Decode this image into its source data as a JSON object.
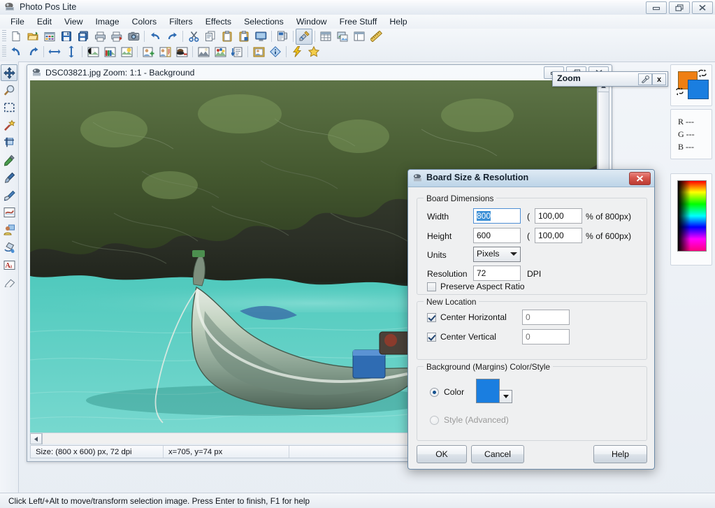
{
  "window": {
    "title": "Photo Pos Lite",
    "icon": "app-icon",
    "controls": [
      {
        "name": "minimize-button",
        "glyph": "minimize"
      },
      {
        "name": "restore-button",
        "glyph": "restore"
      },
      {
        "name": "close-button",
        "glyph": "close"
      }
    ]
  },
  "menu": {
    "items": [
      {
        "label": "File"
      },
      {
        "label": "Edit"
      },
      {
        "label": "View"
      },
      {
        "label": "Image"
      },
      {
        "label": "Colors"
      },
      {
        "label": "Filters"
      },
      {
        "label": "Effects"
      },
      {
        "label": "Selections"
      },
      {
        "label": "Window"
      },
      {
        "label": "Free Stuff"
      },
      {
        "label": "Help"
      }
    ]
  },
  "toolbar": {
    "row1": [
      {
        "name": "new-file-icon"
      },
      {
        "name": "open-file-icon"
      },
      {
        "name": "open-template-icon"
      },
      {
        "name": "save-icon"
      },
      {
        "name": "save-as-icon"
      },
      {
        "name": "print-icon"
      },
      {
        "name": "print-batch-icon"
      },
      {
        "name": "capture-camera-icon"
      },
      {
        "name": "separator"
      },
      {
        "name": "undo-icon"
      },
      {
        "name": "redo-icon"
      },
      {
        "name": "separator"
      },
      {
        "name": "cut-icon"
      },
      {
        "name": "copy-icon"
      },
      {
        "name": "paste-icon"
      },
      {
        "name": "paste-as-new-icon"
      },
      {
        "name": "screen-capture-icon"
      },
      {
        "name": "separator"
      },
      {
        "name": "scanner-icon"
      },
      {
        "name": "separator"
      },
      {
        "name": "board-size-icon"
      },
      {
        "name": "separator"
      },
      {
        "name": "grid-icon"
      },
      {
        "name": "layers-icon"
      },
      {
        "name": "frame-icon"
      },
      {
        "name": "ruler-icon"
      }
    ],
    "row2": [
      {
        "name": "rotate-left-icon"
      },
      {
        "name": "rotate-right-icon"
      },
      {
        "name": "separator"
      },
      {
        "name": "flip-horizontal-icon"
      },
      {
        "name": "flip-vertical-icon"
      },
      {
        "name": "separator"
      },
      {
        "name": "brightness-contrast-icon"
      },
      {
        "name": "color-balance-icon"
      },
      {
        "name": "enhance-icon"
      },
      {
        "name": "separator"
      },
      {
        "name": "add-layer-icon"
      },
      {
        "name": "layer-properties-icon"
      },
      {
        "name": "mask-icon"
      },
      {
        "name": "separator"
      },
      {
        "name": "histogram-icon"
      },
      {
        "name": "color-levels-icon"
      },
      {
        "name": "sort-icon"
      },
      {
        "name": "separator"
      },
      {
        "name": "picture-frame-icon"
      },
      {
        "name": "info-icon"
      },
      {
        "name": "separator"
      },
      {
        "name": "quick-effects-icon"
      },
      {
        "name": "favorites-star-icon"
      }
    ]
  },
  "tools": [
    {
      "name": "tool-move",
      "label": "Move",
      "selected": true
    },
    {
      "name": "tool-zoom",
      "label": "Zoom",
      "selected": false
    },
    {
      "name": "tool-select-rectangle",
      "label": "Rectangle Select",
      "selected": false
    },
    {
      "name": "tool-magic-wand",
      "label": "Magic Wand",
      "selected": false
    },
    {
      "name": "tool-crop",
      "label": "Crop",
      "selected": false
    },
    {
      "name": "tool-eyedropper",
      "label": "Color Picker",
      "selected": false
    },
    {
      "name": "tool-paint-brush",
      "label": "Paint Brush",
      "selected": false
    },
    {
      "name": "tool-clone-brush",
      "label": "Clone Brush",
      "selected": false
    },
    {
      "name": "tool-retouch",
      "label": "Retouch",
      "selected": false
    },
    {
      "name": "tool-red-eye",
      "label": "Red Eye Removal",
      "selected": false
    },
    {
      "name": "tool-fill-bucket",
      "label": "Fill",
      "selected": false
    },
    {
      "name": "tool-text",
      "label": "Text",
      "selected": false
    },
    {
      "name": "tool-eraser",
      "label": "Eraser",
      "selected": false
    }
  ],
  "document": {
    "title": "DSC03821.jpg  Zoom: 1:1 - Background",
    "controls": [
      {
        "name": "doc-minimize-button"
      },
      {
        "name": "doc-restore-button"
      },
      {
        "name": "doc-close-button"
      }
    ],
    "status": {
      "size": "Size: (800 x 600) px, 72 dpi",
      "cursor": "x=705, y=74 px",
      "extra": ""
    }
  },
  "zoom_palette": {
    "title": "Zoom",
    "roll_label": "",
    "close_label": "x"
  },
  "right_panel": {
    "foreground_color": "#ef7f12",
    "background_color": "#1a7ee0",
    "readout": [
      {
        "channel": "R",
        "value": "---"
      },
      {
        "channel": "G",
        "value": "---"
      },
      {
        "channel": "B",
        "value": "---"
      }
    ]
  },
  "dialog": {
    "title": "Board Size & Resolution",
    "close_label": "",
    "groups": {
      "dimensions": {
        "legend": "Board Dimensions",
        "width_label": "Width",
        "width_value": "800",
        "width_pct_prefix": "(",
        "width_pct_value": "100,00",
        "width_pct_suffix": "% of 800px)",
        "height_label": "Height",
        "height_value": "600",
        "height_pct_prefix": "(",
        "height_pct_value": "100,00",
        "height_pct_suffix": "% of 600px)",
        "units_label": "Units",
        "units_value": "Pixels",
        "resolution_label": "Resolution",
        "resolution_value": "72",
        "resolution_unit": "DPI",
        "preserve_label": "Preserve Aspect Ratio",
        "preserve_checked": false
      },
      "location": {
        "legend": "New Location",
        "center_h_label": "Center Horizontal",
        "center_h_checked": true,
        "center_h_value": "0",
        "center_v_label": "Center Vertical",
        "center_v_checked": true,
        "center_v_value": "0"
      },
      "background": {
        "legend": "Background (Margins) Color/Style",
        "color_label": "Color",
        "color_selected": true,
        "color_value": "#1a7ee0",
        "style_label": "Style (Advanced)",
        "style_selected": false,
        "style_disabled": true
      }
    },
    "buttons": {
      "ok": "OK",
      "cancel": "Cancel",
      "help": "Help"
    }
  },
  "statusbar": {
    "hint": "Click Left/+Alt to move/transform selection image. Press Enter to finish, F1 for help"
  }
}
